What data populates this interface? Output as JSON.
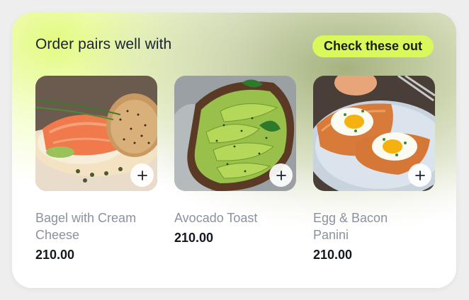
{
  "header": {
    "title": "Order pairs well with",
    "cta_label": "Check these out"
  },
  "colors": {
    "cta_background": "#d8f85c",
    "title_text": "#1c2330",
    "product_name_text": "#8a92a0",
    "price_text": "#14191f"
  },
  "products": [
    {
      "name": "Bagel with Cream Cheese",
      "price": "210.00",
      "image": "bagel-salmon-photo",
      "add_icon": "plus-icon"
    },
    {
      "name": "Avocado Toast",
      "price": "210.00",
      "image": "avocado-toast-photo",
      "add_icon": "plus-icon"
    },
    {
      "name": "Egg & Bacon Panini",
      "price": "210.00",
      "image": "egg-bacon-panini-photo",
      "add_icon": "plus-icon"
    }
  ]
}
